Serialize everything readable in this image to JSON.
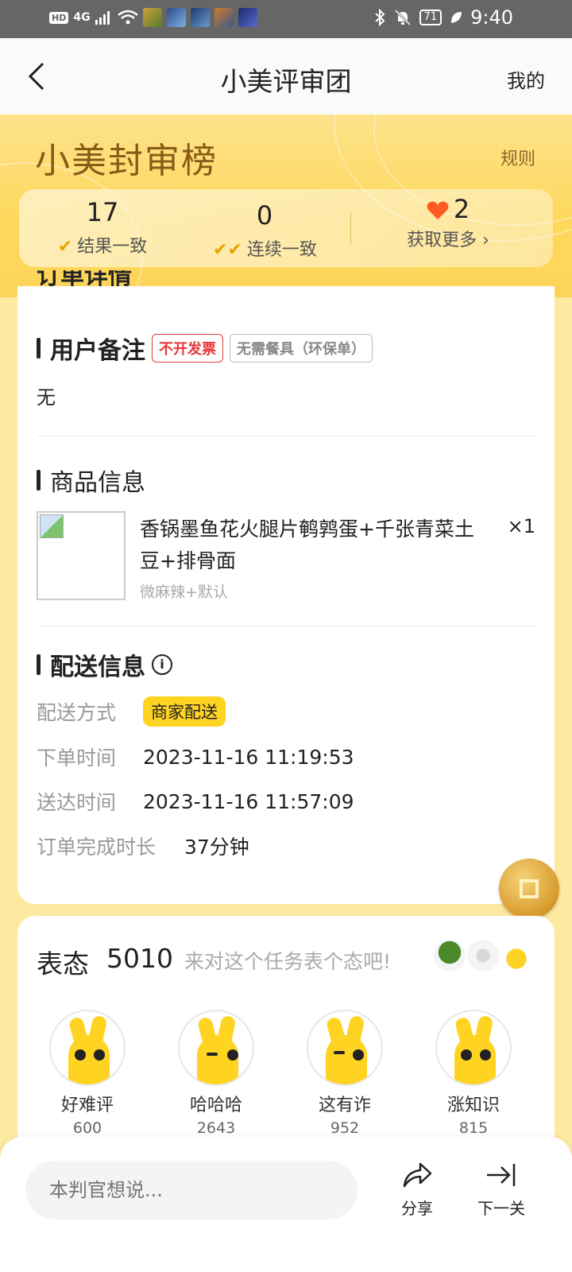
{
  "status_bar": {
    "hd": "HD",
    "network": "4G",
    "battery": "71",
    "time": "9:40"
  },
  "nav": {
    "title": "小美评审团",
    "right": "我的"
  },
  "hero": {
    "brand": "小美封审榜",
    "rules": "规则",
    "stats": [
      {
        "value": "17",
        "label": "结果一致"
      },
      {
        "value": "0",
        "label": "连续一致"
      },
      {
        "value": "2",
        "label": "获取更多 ›"
      }
    ]
  },
  "order": {
    "cut_heading": "订单详情",
    "remark": {
      "title": "用户备注",
      "tags": [
        "不开发票",
        "无需餐具（环保单）"
      ],
      "text": "无"
    },
    "product": {
      "title": "商品信息",
      "name": "香锅墨鱼花火腿片鹌鹑蛋+千张青菜土豆+排骨面",
      "qty": "×1",
      "spec": "微麻辣+默认"
    },
    "delivery": {
      "title": "配送信息",
      "rows": [
        {
          "key": "配送方式",
          "value": "商家配送"
        },
        {
          "key": "下单时间",
          "value": "2023-11-16 11:19:53"
        },
        {
          "key": "送达时间",
          "value": "2023-11-16 11:57:09"
        },
        {
          "key": "订单完成时长",
          "value": "37分钟"
        }
      ]
    }
  },
  "biaotai": {
    "title": "表态",
    "count": "5010",
    "hint": "来对这个任务表个态吧!",
    "reactions": [
      {
        "label": "好难评",
        "count": "600"
      },
      {
        "label": "哈哈哈",
        "count": "2643"
      },
      {
        "label": "这有诈",
        "count": "952"
      },
      {
        "label": "涨知识",
        "count": "815"
      }
    ]
  },
  "bottom": {
    "placeholder": "本判官想说...",
    "share": "分享",
    "next": "下一关"
  },
  "colors": {
    "accent_yellow": "#fed321",
    "tag_red": "#e5393b",
    "heart": "#ff5a1f"
  }
}
